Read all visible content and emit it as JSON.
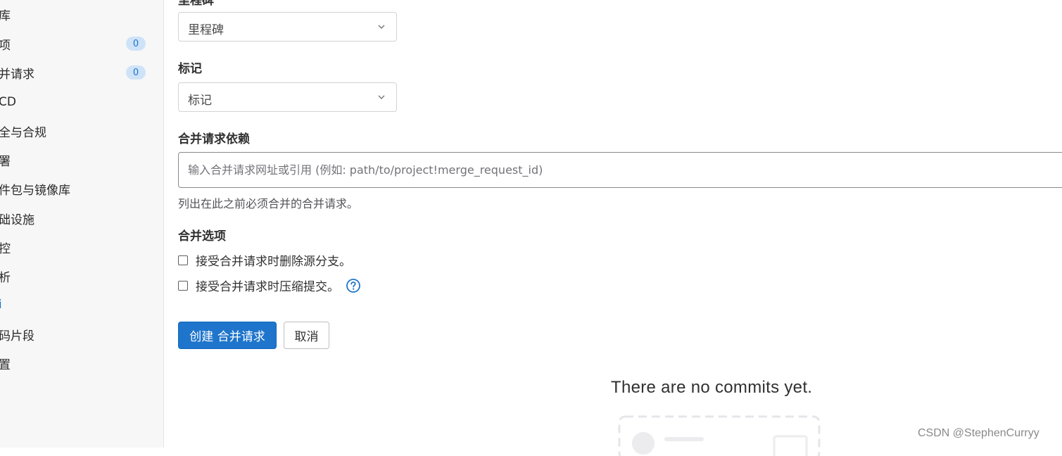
{
  "sidebar": {
    "items": [
      {
        "label": "库",
        "badge": null
      },
      {
        "label": "项",
        "badge": "0"
      },
      {
        "label": "并请求",
        "badge": "0"
      },
      {
        "label": "CD",
        "badge": null
      },
      {
        "label": "全与合规",
        "badge": null
      },
      {
        "label": "署",
        "badge": null
      },
      {
        "label": "件包与镜像库",
        "badge": null
      },
      {
        "label": "础设施",
        "badge": null
      },
      {
        "label": "控",
        "badge": null
      },
      {
        "label": "析",
        "badge": null
      },
      {
        "label": "i",
        "badge": null
      },
      {
        "label": "码片段",
        "badge": null
      },
      {
        "label": "置",
        "badge": null
      }
    ]
  },
  "form": {
    "milestone_label": "里程碑",
    "milestone_value": "里程碑",
    "labels_label": "标记",
    "labels_value": "标记",
    "dependencies_label": "合并请求依赖",
    "dependencies_placeholder": "输入合并请求网址或引用 (例如: path/to/project!merge_request_id)",
    "dependencies_value": "",
    "dependencies_help": "列出在此之前必须合并的合并请求。",
    "merge_options_label": "合并选项",
    "option_delete_source": "接受合并请求时删除源分支。",
    "option_squash": "接受合并请求时压缩提交。",
    "create_button": "创建 合并请求",
    "cancel_button": "取消"
  },
  "commits": {
    "empty_title": "There are no commits yet."
  },
  "watermark": "CSDN @StephenCurryy",
  "colors": {
    "primary": "#1f75cb",
    "badge_bg": "#cfe3f8",
    "sidebar_bg": "#f7f7f8"
  }
}
